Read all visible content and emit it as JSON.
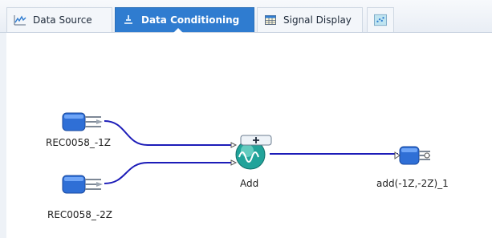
{
  "tabs": [
    {
      "label": "Data Source",
      "icon": "waveform-chart-icon",
      "active": false
    },
    {
      "label": "Data Conditioning",
      "icon": "conditioning-icon",
      "active": true
    },
    {
      "label": "Signal Display",
      "icon": "table-grid-icon",
      "active": false
    },
    {
      "label": "",
      "icon": "scatter-plot-icon",
      "active": false
    }
  ],
  "graph": {
    "input1": {
      "label": "REC0058_-1Z"
    },
    "input2": {
      "label": "REC0058_-2Z"
    },
    "operation": {
      "label": "Add"
    },
    "output": {
      "label": "add(-1Z,-2Z)_1"
    }
  },
  "colors": {
    "active_tab": "#2f7cd0",
    "wire": "#1c1cb8",
    "node_blue": "#2f6fd6",
    "op_teal": "#22a39a"
  }
}
